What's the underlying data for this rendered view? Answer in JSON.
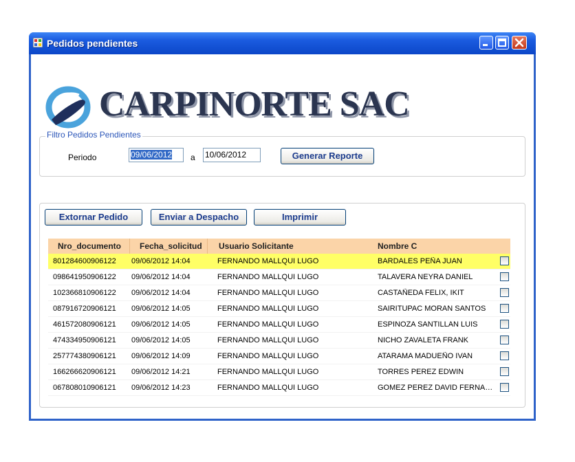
{
  "window": {
    "title": "Pedidos pendientes"
  },
  "titlebar_buttons": {
    "minimize_icon": "minimize-icon",
    "maximize_icon": "maximize-icon",
    "close_icon": "close-icon"
  },
  "brand": {
    "name": "CARPINORTE SAC",
    "logo_icon": "carpinorte-logo"
  },
  "filter": {
    "legend": "Filtro Pedidos Pendientes",
    "period_label": "Periodo",
    "date_from": "09/06/2012",
    "separator": "a",
    "date_to": "10/06/2012",
    "generate_button": "Generar Reporte"
  },
  "actions": {
    "extornar": "Extornar Pedido",
    "enviar": "Enviar a Despacho",
    "imprimir": "Imprimir"
  },
  "table": {
    "columns": [
      "Nro_documento",
      "Fecha_solicitud",
      "Usuario Solicitante",
      "Nombre C"
    ],
    "rows": [
      [
        "801284600906122",
        "09/06/2012 14:04",
        "FERNANDO MALLQUI LUGO",
        "BARDALES PEÑA JUAN"
      ],
      [
        "098641950906122",
        "09/06/2012 14:04",
        "FERNANDO MALLQUI LUGO",
        "TALAVERA NEYRA DANIEL"
      ],
      [
        "102366810906122",
        "09/06/2012 14:04",
        "FERNANDO MALLQUI LUGO",
        "CASTAÑEDA FELIX, IKIT"
      ],
      [
        "087916720906121",
        "09/06/2012 14:05",
        "FERNANDO MALLQUI LUGO",
        "SAIRITUPAC MORAN SANTOS"
      ],
      [
        "461572080906121",
        "09/06/2012 14:05",
        "FERNANDO MALLQUI LUGO",
        "ESPINOZA SANTILLAN LUIS"
      ],
      [
        "474334950906121",
        "09/06/2012 14:05",
        "FERNANDO MALLQUI LUGO",
        "NICHO ZAVALETA FRANK"
      ],
      [
        "257774380906121",
        "09/06/2012 14:09",
        "FERNANDO MALLQUI LUGO",
        "ATARAMA MADUEÑO IVAN"
      ],
      [
        "166266620906121",
        "09/06/2012 14:21",
        "FERNANDO MALLQUI LUGO",
        "TORRES  PEREZ  EDWIN"
      ],
      [
        "067808010906121",
        "09/06/2012 14:23",
        "FERNANDO MALLQUI LUGO",
        "GOMEZ PEREZ DAVID FERNAN..."
      ]
    ],
    "highlight_color": "#ffff66",
    "header_color": "#fbd4a8"
  }
}
